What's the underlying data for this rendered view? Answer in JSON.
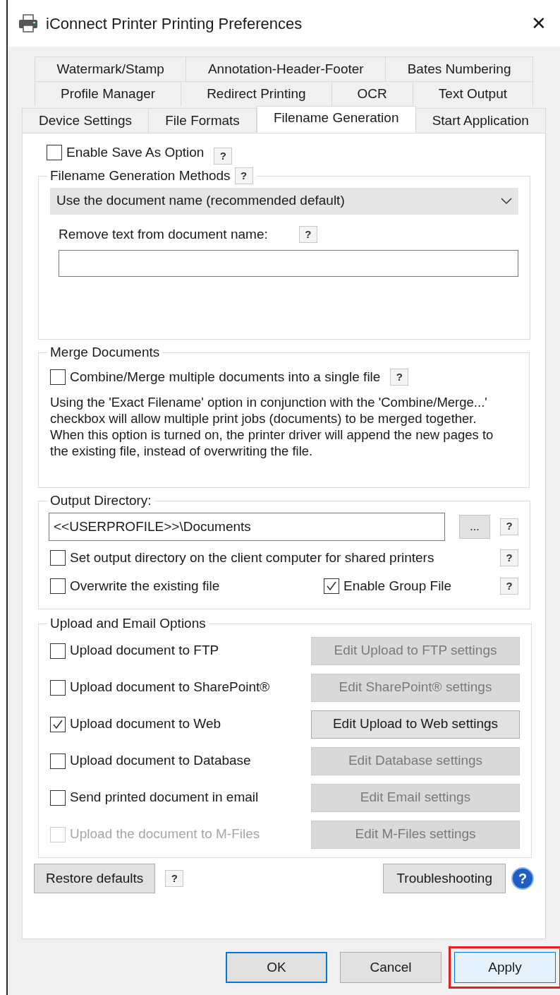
{
  "window": {
    "title": "iConnect Printer Printing Preferences",
    "close": "✕"
  },
  "tab_rows": [
    [
      {
        "label": "Watermark/Stamp",
        "selected": false
      },
      {
        "label": "Annotation-Header-Footer",
        "selected": false
      },
      {
        "label": "Bates Numbering",
        "selected": false
      }
    ],
    [
      {
        "label": "Profile Manager",
        "selected": false
      },
      {
        "label": "Redirect Printing",
        "selected": false
      },
      {
        "label": "OCR",
        "selected": false
      },
      {
        "label": "Text Output",
        "selected": false
      }
    ],
    [
      {
        "label": "Device Settings",
        "selected": false
      },
      {
        "label": "File Formats",
        "selected": false
      },
      {
        "label": "Filename Generation",
        "selected": true
      },
      {
        "label": "Start Application",
        "selected": false
      }
    ]
  ],
  "save_as": {
    "label": "Enable Save As Option",
    "checked": false,
    "help": "?"
  },
  "filename_methods": {
    "title": "Filename Generation Methods",
    "help": "?",
    "dropdown": "Use the document name (recommended default)",
    "remove_label": "Remove text from document name:",
    "remove_help": "?"
  },
  "merge": {
    "title": "Merge Documents",
    "label": "Combine/Merge multiple documents into a single file",
    "checked": false,
    "help": "?",
    "description": "Using the 'Exact Filename' option in conjunction with the 'Combine/Merge...' checkbox will allow multiple print jobs (documents) to be merged together. When this option is turned on, the printer driver will append the new pages to the existing file, instead of overwriting the file."
  },
  "output": {
    "title": "Output Directory:",
    "path": "<<USERPROFILE>>\\Documents",
    "browse": "...",
    "help": "?",
    "client_option": {
      "label": "Set output directory on the client computer for shared printers",
      "checked": false,
      "help": "?"
    },
    "overwrite": {
      "label": "Overwrite the existing file",
      "checked": false
    },
    "group_file": {
      "label": "Enable Group File",
      "checked": true,
      "help": "?"
    }
  },
  "upload": {
    "title": "Upload and Email Options",
    "rows": [
      {
        "label": "Upload document to FTP",
        "checked": false,
        "disabled": false,
        "button": {
          "label": "Edit Upload to FTP settings",
          "disabled": true
        }
      },
      {
        "label": "Upload document to SharePoint®",
        "checked": false,
        "disabled": false,
        "button": {
          "label": "Edit SharePoint® settings",
          "disabled": true
        }
      },
      {
        "label": "Upload document to Web",
        "checked": true,
        "disabled": false,
        "button": {
          "label": "Edit Upload to Web settings",
          "disabled": false
        }
      },
      {
        "label": "Upload document to Database",
        "checked": false,
        "disabled": false,
        "button": {
          "label": "Edit Database settings",
          "disabled": true
        }
      },
      {
        "label": "Send printed document in email",
        "checked": false,
        "disabled": false,
        "button": {
          "label": "Edit Email settings",
          "disabled": true
        }
      },
      {
        "label": "Upload the document to M-Files",
        "checked": false,
        "disabled": true,
        "button": {
          "label": "Edit M-Files settings",
          "disabled": true
        }
      }
    ]
  },
  "footer": {
    "restore": "Restore defaults",
    "restore_help": "?",
    "troubleshooting": "Troubleshooting",
    "troubleshooting_help": "?"
  },
  "buttons": [
    {
      "label": "OK",
      "focused": true,
      "highlighted": false
    },
    {
      "label": "Cancel",
      "focused": false,
      "highlighted": false
    },
    {
      "label": "Apply",
      "focused": false,
      "highlighted": true
    }
  ]
}
